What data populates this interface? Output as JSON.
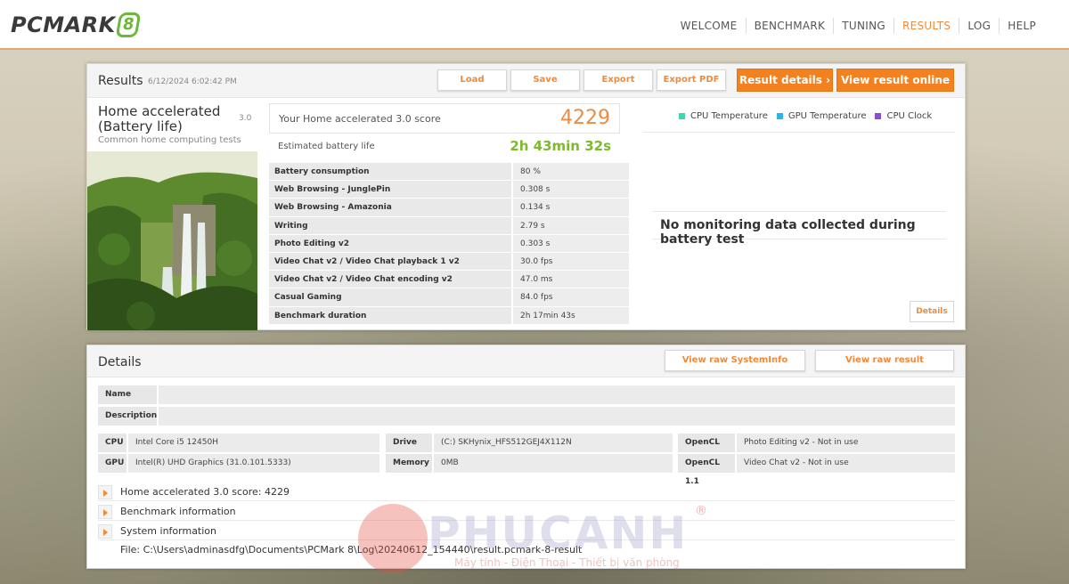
{
  "app": {
    "logo_text": "PCMARK",
    "logo_badge": "8",
    "nav": [
      {
        "label": "WELCOME",
        "active": false
      },
      {
        "label": "BENCHMARK",
        "active": false
      },
      {
        "label": "TUNING",
        "active": false
      },
      {
        "label": "RESULTS",
        "active": true
      },
      {
        "label": "LOG",
        "active": false
      },
      {
        "label": "HELP",
        "active": false
      }
    ],
    "accent_color": "#f08a3c"
  },
  "results": {
    "title": "Results",
    "date": "6/12/2024 6:02:42 PM",
    "buttons": {
      "load": "Load",
      "save": "Save",
      "export": "Export",
      "export_pdf": "Export PDF",
      "result_details": "Result details",
      "view_online": "View result online"
    },
    "test_name": "Home accelerated (Battery life)",
    "test_version": "3.0",
    "test_subtitle": "Common home computing tests",
    "score_label": "Your Home accelerated 3.0 score",
    "score_value": "4229",
    "battery_label": "Estimated battery life",
    "battery_value": "2h 43min 32s",
    "metrics": [
      {
        "name": "Battery consumption",
        "value": "80 %"
      },
      {
        "name": "Web Browsing - JunglePin",
        "value": "0.308 s"
      },
      {
        "name": "Web Browsing - Amazonia",
        "value": "0.134 s"
      },
      {
        "name": "Writing",
        "value": "2.79 s"
      },
      {
        "name": "Photo Editing v2",
        "value": "0.303 s"
      },
      {
        "name": "Video Chat v2 / Video Chat playback 1 v2",
        "value": "30.0 fps"
      },
      {
        "name": "Video Chat v2 / Video Chat encoding v2",
        "value": "47.0 ms"
      },
      {
        "name": "Casual Gaming",
        "value": "84.0 fps"
      },
      {
        "name": "Benchmark duration",
        "value": "2h 17min 43s"
      }
    ],
    "monitoring": {
      "legend": [
        {
          "label": "CPU Temperature",
          "color": "#3fd6b4"
        },
        {
          "label": "GPU Temperature",
          "color": "#2ab5e8"
        },
        {
          "label": "CPU Clock",
          "color": "#8a4fd0"
        }
      ],
      "no_data_text": "No monitoring data collected during battery test",
      "details_button": "Details"
    }
  },
  "details": {
    "title": "Details",
    "raw_sysinfo_button": "View raw SystemInfo",
    "raw_result_button": "View raw result",
    "name_label": "Name",
    "name_value": "",
    "description_label": "Description",
    "description_value": "",
    "cpu_label": "CPU",
    "cpu_value": "Intel Core i5 12450H",
    "gpu_label": "GPU",
    "gpu_value": "Intel(R) UHD Graphics (31.0.101.5333)",
    "drive_label": "Drive",
    "drive_value": "(C:) SKHynix_HFS512GEJ4X112N",
    "memory_label": "Memory",
    "memory_value": "0MB",
    "opencl1_label": "OpenCL 1.1",
    "opencl1_value": "Photo Editing v2 - Not in use",
    "opencl2_label": "OpenCL 1.1",
    "opencl2_value": "Video Chat v2 - Not in use",
    "expanders": [
      "Home accelerated 3.0 score: 4229",
      "Benchmark information",
      "System information"
    ],
    "file_path": "File: C:\\Users\\adminasdfg\\Documents\\PCMark 8\\Log\\20240612_154440\\result.pcmark-8-result"
  },
  "watermark": {
    "brand": "PHUCANH",
    "registered": "®",
    "tagline": "Máy tính - Điện Thoại - Thiết bị văn phòng"
  }
}
